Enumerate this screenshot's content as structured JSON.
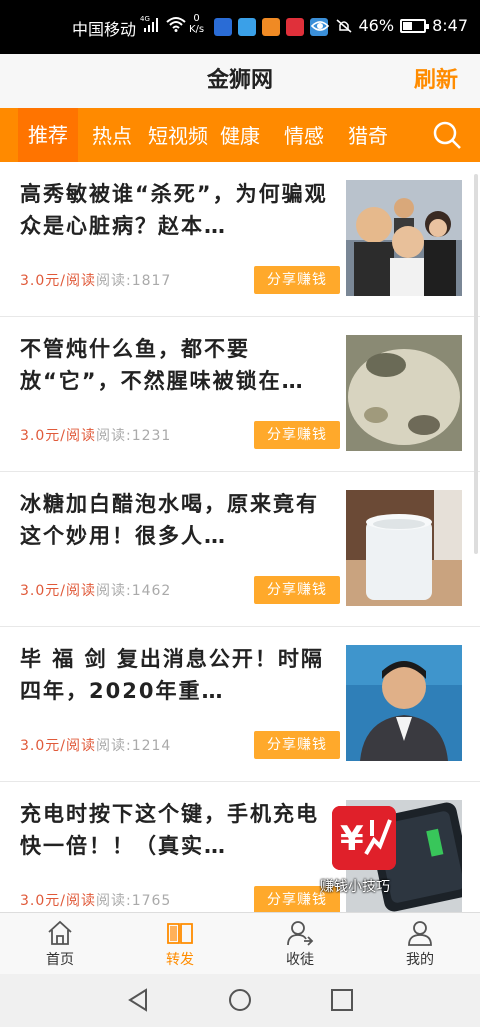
{
  "status_bar": {
    "carrier": "中国移动",
    "network": "4G",
    "speed_value": "0",
    "speed_unit": "K/s",
    "battery": "46%",
    "battery_level": 0.46,
    "time": "8:47"
  },
  "header": {
    "title": "金狮网",
    "refresh_label": "刷新"
  },
  "tabs": [
    {
      "label": "推荐",
      "active": true
    },
    {
      "label": "热点"
    },
    {
      "label": "短视频"
    },
    {
      "label": "健康"
    },
    {
      "label": "情感"
    },
    {
      "label": "猎奇"
    }
  ],
  "articles": [
    {
      "title": "高秀敏被谁“杀死”，为何骗观众是心脏病？赵本…",
      "price": "3.0元/阅读",
      "reads": "阅读:1817",
      "share_label": "分享赚钱"
    },
    {
      "title": "不管炖什么鱼，都不要放“它”，不然腥味被锁在…",
      "price": "3.0元/阅读",
      "reads": "阅读:1231",
      "share_label": "分享赚钱"
    },
    {
      "title": "冰糖加白醋泡水喝，原来竟有这个妙用！很多人…",
      "price": "3.0元/阅读",
      "reads": "阅读:1462",
      "share_label": "分享赚钱"
    },
    {
      "title": "毕 福 剑 复出消息公开！时隔四年，2020年重…",
      "price": "3.0元/阅读",
      "reads": "阅读:1214",
      "share_label": "分享赚钱"
    },
    {
      "title": "充电时按下这个键，手机充电快一倍！！（真实…",
      "price": "3.0元/阅读",
      "reads": "阅读:1765",
      "share_label": "分享赚钱"
    }
  ],
  "promo": {
    "label": "赚钱小技巧"
  },
  "bottom_nav": [
    {
      "label": "首页",
      "icon": "home-icon"
    },
    {
      "label": "转发",
      "icon": "book-icon",
      "active": true
    },
    {
      "label": "收徒",
      "icon": "add-user-icon"
    },
    {
      "label": "我的",
      "icon": "profile-icon"
    }
  ],
  "colors": {
    "accent": "#ff8a00",
    "price": "#e05a3a",
    "share_button": "#ffa92b"
  }
}
